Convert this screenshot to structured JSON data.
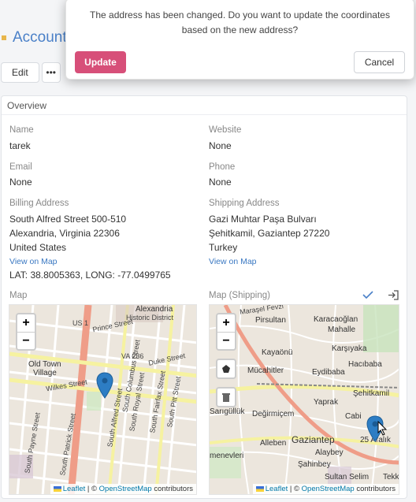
{
  "page": {
    "title": "Account"
  },
  "toolbar": {
    "edit_label": "Edit",
    "more_label": "•••"
  },
  "panel": {
    "title": "Overview",
    "name": {
      "label": "Name",
      "value": "tarek"
    },
    "website": {
      "label": "Website",
      "value": "None"
    },
    "email": {
      "label": "Email",
      "value": "None"
    },
    "phone": {
      "label": "Phone",
      "value": "None"
    },
    "billing": {
      "label": "Billing Address",
      "line1": "South Alfred Street 500-510",
      "line2": "Alexandria, Virginia 22306",
      "line3": "United States",
      "view_map": "View on Map",
      "coords": "LAT: 38.8005363, LONG: -77.0499765"
    },
    "shipping": {
      "label": "Shipping Address",
      "line1": "Gazi Muhtar Paşa Bulvarı",
      "line2": "Şehitkamil, Gaziantep 27220",
      "line3": "Turkey",
      "view_map": "View on Map"
    },
    "map_label": "Map",
    "map_shipping_label": "Map (Shipping)"
  },
  "map_billing": {
    "labels": [
      "Alexandria",
      "Historic District",
      "US 1",
      "Prince Street",
      "VA 236",
      "Duke Street",
      "Old Town",
      "Village",
      "Wilkes Street",
      "South Alfred Street",
      "South Columbus Street",
      "South Patrick Street",
      "South Payne Street",
      "South Royal Street",
      "South Fairfax Street",
      "South Pitt Street"
    ],
    "zoom_in": "+",
    "zoom_out": "−"
  },
  "map_shipping": {
    "labels": [
      "Maraşel Fevzi",
      "Pirsultan",
      "Karacaoğlan",
      "Mahalle",
      "Kayaönü",
      "Karşıyaka",
      "Mücahitler",
      "Eydibaba",
      "Hacıbaba",
      "Şehitkamil",
      "Sarıgüllük",
      "Değirmiçem",
      "Yaprak",
      "Cabi",
      "Gaziantep",
      "Alleben",
      "25 Aralık",
      "Alaybey",
      "Şahinbey",
      "menevleri",
      "Sultan Selim",
      "Tekke"
    ],
    "zoom_in": "+",
    "zoom_out": "−"
  },
  "attribution": {
    "leaflet": "Leaflet",
    "sep": "| ©",
    "osm": "OpenStreetMap",
    "contrib": "contributors"
  },
  "modal": {
    "message": "The address has been changed. Do you want to update the coordinates based on the new address?",
    "update_label": "Update",
    "cancel_label": "Cancel"
  },
  "colors": {
    "accent": "#d74f79",
    "link": "#3a78c2",
    "title": "#4a80c8",
    "marker": "#2d7dc4"
  }
}
